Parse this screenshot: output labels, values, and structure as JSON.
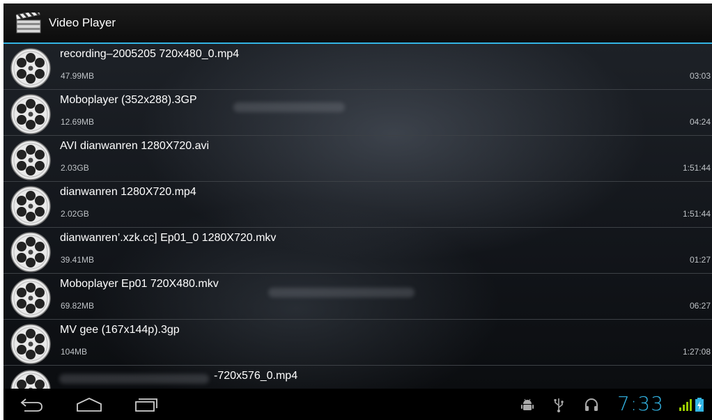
{
  "app": {
    "title": "Video Player"
  },
  "videos": [
    {
      "name": "recording–2005205 720x480_0.mp4",
      "size": "47.99MB",
      "duration": "03:03"
    },
    {
      "name": "Moboplayer  (352x288).3GP",
      "size": "12.69MB",
      "duration": "04:24"
    },
    {
      "name": "AVI  dianwanren 1280X720.avi",
      "size": "2.03GB",
      "duration": "1:51:44"
    },
    {
      "name": " dianwanren 1280X720.mp4",
      "size": "2.02GB",
      "duration": "1:51:44"
    },
    {
      "name": "dianwanren’.xzk.cc]   Ep01_0 1280X720.mkv",
      "size": "39.41MB",
      "duration": "01:27"
    },
    {
      "name": "Moboplayer  Ep01 720X480.mkv",
      "size": "69.82MB",
      "duration": "06:27"
    },
    {
      "name": "MV  gee (167x144p).3gp",
      "size": "104MB",
      "duration": "1:27:08"
    },
    {
      "name": "-720x576_0.mp4",
      "size": "",
      "duration": ""
    }
  ],
  "status": {
    "time": "7:33"
  },
  "icons": {
    "app": "clapperboard-icon",
    "item": "film-reel-icon",
    "back": "back-icon",
    "home": "home-icon",
    "recents": "recent-apps-icon",
    "debug": "android-debug-icon",
    "usb": "usb-icon",
    "headset": "headphones-icon",
    "signal": "signal-icon",
    "battery": "battery-icon"
  },
  "colors": {
    "accent": "#33b5e5",
    "signal": "#99cc00"
  }
}
